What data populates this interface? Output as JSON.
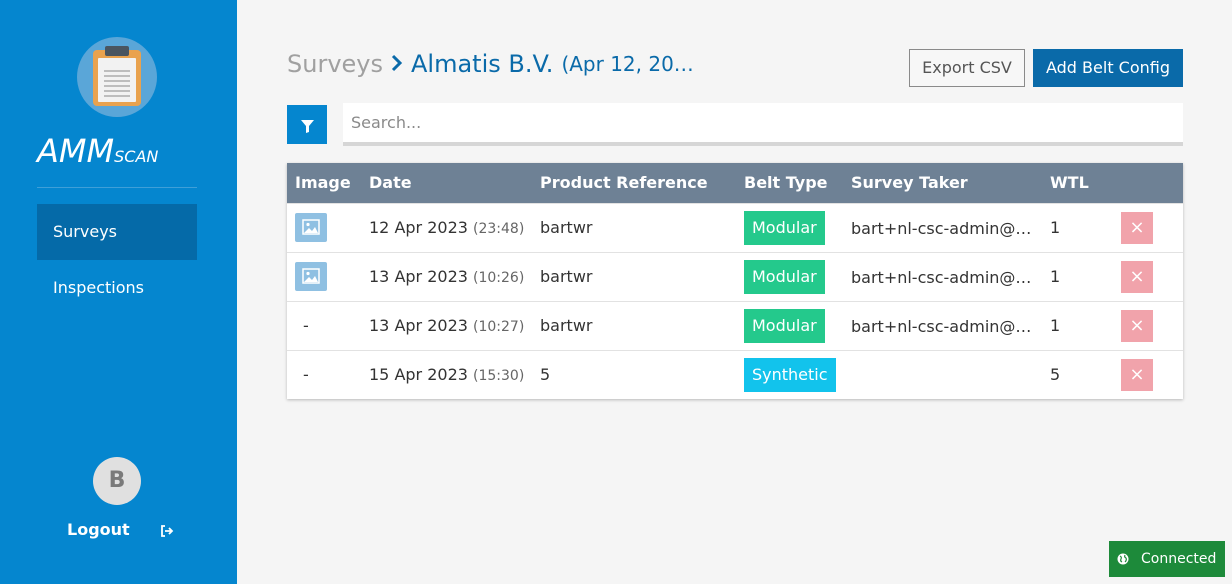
{
  "sidebar": {
    "brand_main": "AMM",
    "brand_sub": "SCAN",
    "logo_icon": "clipboard-icon",
    "nav": [
      {
        "label": "Surveys",
        "active": true
      },
      {
        "label": "Inspections",
        "active": false
      }
    ],
    "user_initial": "B",
    "logout_label": "Logout",
    "logout_icon": "sign-out-icon"
  },
  "header": {
    "breadcrumb_root": "Surveys",
    "breadcrumb_current": "Almatis B.V.",
    "breadcrumb_date": "(Apr 12, 20…",
    "export_label": "Export CSV",
    "add_label": "Add Belt Config"
  },
  "search": {
    "placeholder": "Search...",
    "filter_icon": "filter-icon"
  },
  "table": {
    "headers": [
      "Image",
      "Date",
      "Product Reference",
      "Belt Type",
      "Survey Taker",
      "WTL",
      ""
    ],
    "rows": [
      {
        "image": "image-icon",
        "date": "12 Apr 2023",
        "time": "(23:48)",
        "product": "bartwr",
        "belt": "Modular",
        "taker": "bart+nl-csc-admin@…",
        "wtl": "1"
      },
      {
        "image": "image-icon",
        "date": "13 Apr 2023",
        "time": "(10:26)",
        "product": "bartwr",
        "belt": "Modular",
        "taker": "bart+nl-csc-admin@…",
        "wtl": "1"
      },
      {
        "image": "-",
        "date": "13 Apr 2023",
        "time": "(10:27)",
        "product": "bartwr",
        "belt": "Modular",
        "taker": "bart+nl-csc-admin@…",
        "wtl": "1"
      },
      {
        "image": "-",
        "date": "15 Apr 2023",
        "time": "(15:30)",
        "product": "5",
        "belt": "Synthetic",
        "taker": "",
        "wtl": "5"
      }
    ],
    "delete_glyph": "×"
  },
  "status": {
    "label": "Connected",
    "icon": "globe-icon"
  },
  "colors": {
    "sidebar": "#0586cf",
    "primary": "#0a6aa9",
    "modular": "#24c98c",
    "synthetic": "#12c3ec",
    "delete": "#f1a3ab",
    "connected": "#1d8a3a"
  }
}
